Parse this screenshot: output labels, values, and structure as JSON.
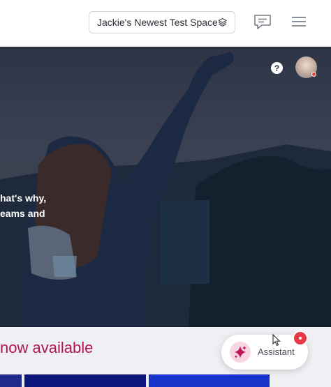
{
  "topbar": {
    "space_name": "Jackie's Newest Test Space",
    "layers_icon": "layers-icon",
    "chat_icon": "chat-bubble-icon",
    "menu_icon": "hamburger-menu-icon"
  },
  "hero": {
    "line1": "hat's why,",
    "line2": "eams and",
    "help_label": "?"
  },
  "section": {
    "heading": "now available"
  },
  "assistant": {
    "label": "Assistant",
    "icon": "sparkle-icon"
  },
  "colors": {
    "accent": "#b0164f",
    "badge": "#e53945"
  }
}
